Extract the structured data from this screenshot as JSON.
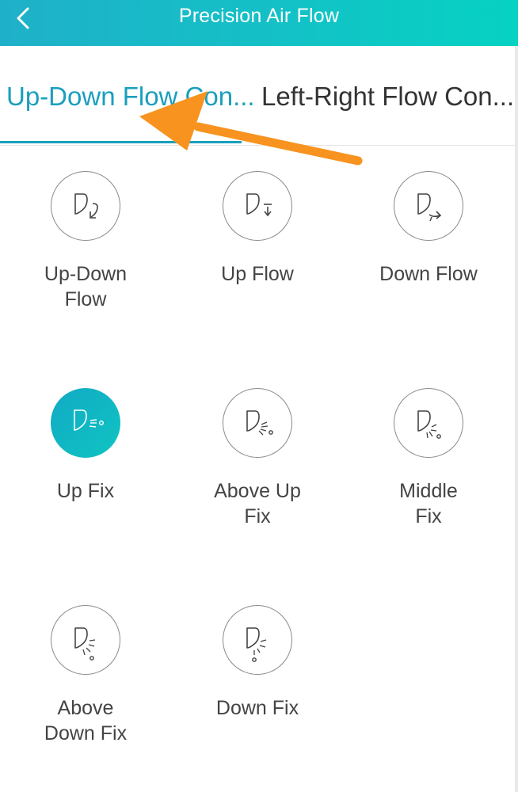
{
  "header": {
    "title": "Precision Air Flow",
    "back_icon": "chevron-left-icon"
  },
  "tabs": [
    {
      "label": "Up-Down Flow Con...",
      "active": true
    },
    {
      "label": "Left-Right Flow Con...",
      "active": false
    }
  ],
  "modes": [
    {
      "label_lines": [
        "Up-Down",
        "Flow"
      ],
      "icon": "up-down-flow-icon",
      "selected": false
    },
    {
      "label_lines": [
        "Up Flow"
      ],
      "icon": "up-flow-icon",
      "selected": false
    },
    {
      "label_lines": [
        "Down Flow"
      ],
      "icon": "down-flow-icon",
      "selected": false
    },
    {
      "label_lines": [
        "Up Fix"
      ],
      "icon": "up-fix-icon",
      "selected": true
    },
    {
      "label_lines": [
        "Above Up",
        "Fix"
      ],
      "icon": "above-up-fix-icon",
      "selected": false
    },
    {
      "label_lines": [
        "Middle",
        "Fix"
      ],
      "icon": "middle-fix-icon",
      "selected": false
    },
    {
      "label_lines": [
        "Above",
        "Down Fix"
      ],
      "icon": "above-down-fix-icon",
      "selected": false
    },
    {
      "label_lines": [
        "Down Fix"
      ],
      "icon": "down-fix-icon",
      "selected": false
    }
  ],
  "colors": {
    "accent": "#1a9fbd",
    "header_gradient_start": "#1fb0c9",
    "header_gradient_end": "#06d2c2",
    "annotation_arrow": "#f7931e"
  }
}
